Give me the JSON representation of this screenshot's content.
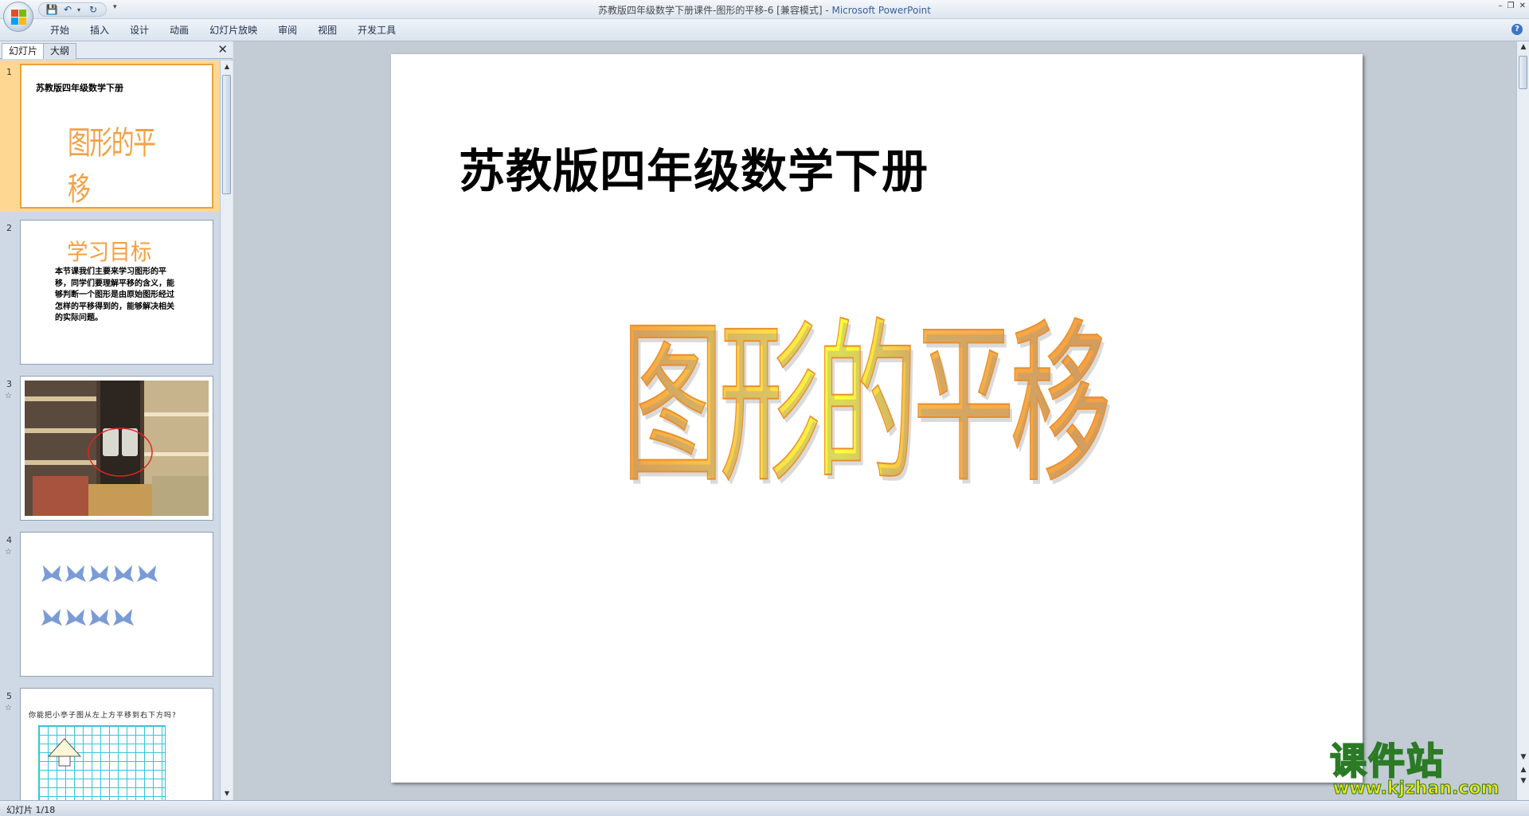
{
  "window": {
    "title_doc": "苏教版四年级数学下册课件-图形的平移-6 [兼容模式] - ",
    "title_app": "Microsoft PowerPoint"
  },
  "ribbon": {
    "tabs": [
      "开始",
      "插入",
      "设计",
      "动画",
      "幻灯片放映",
      "审阅",
      "视图",
      "开发工具"
    ]
  },
  "left_pane": {
    "tab_slides": "幻灯片",
    "tab_outline": "大纲",
    "thumbnails": [
      {
        "num": "1",
        "title": "苏教版四年级数学下册",
        "big": "图形的平移"
      },
      {
        "num": "2",
        "title": "学习目标",
        "body": "本节课我们主要来学习图形的平移，同学们要理解平移的含义，能够判断一个图形是由原始图形经过怎样的平移得到的，能够解决相关的实际问题。"
      },
      {
        "num": "3"
      },
      {
        "num": "4"
      },
      {
        "num": "5",
        "text": "你能把小亭子图从左上方平移到右下方吗?"
      }
    ]
  },
  "slide": {
    "title": "苏教版四年级数学下册",
    "big_text": "图形的平移"
  },
  "status": {
    "slide_indicator": "幻灯片 1/18"
  },
  "watermark": {
    "cn": "课件站",
    "url": "www.kjzhan.com"
  },
  "colors": {
    "accent_orange": "#f3a042",
    "accent_yellow": "#ffff3a",
    "selected_thumb": "#fed892",
    "butterfly": "#7b9bd6"
  }
}
